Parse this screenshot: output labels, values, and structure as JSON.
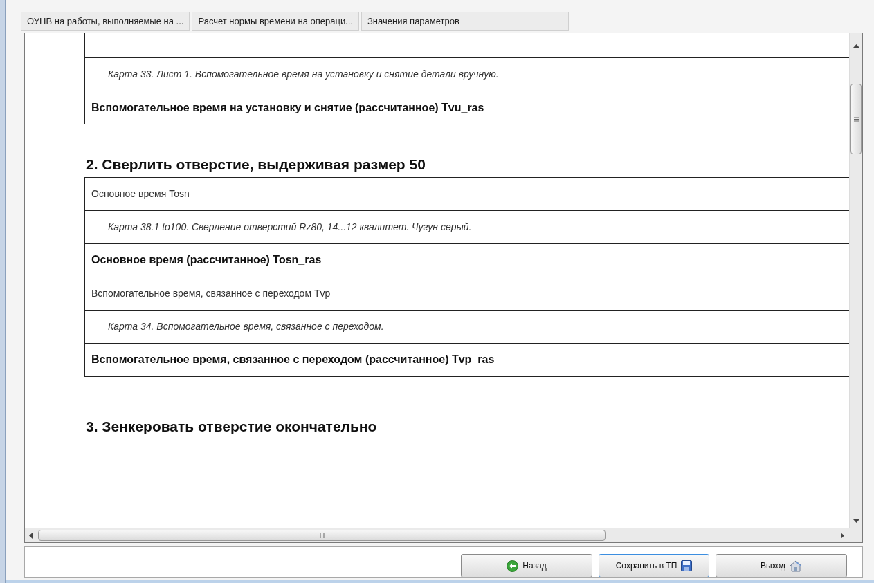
{
  "tabs": [
    {
      "label": "ОУНВ на работы, выполняемые на ...",
      "selected": false
    },
    {
      "label": "Расчет нормы времени на операци...",
      "selected": false
    },
    {
      "label": "Значения параметров",
      "selected": false
    }
  ],
  "document": {
    "sections": [
      {
        "rows": [
          {
            "kind": "reference",
            "text": "Карта 33. Лист 1. Вспомогательное время на установку и снятие детали вручную."
          },
          {
            "kind": "result",
            "text": "Вспомогательное время на установку и снятие (рассчитанное) Tvu_ras"
          }
        ]
      },
      {
        "heading": "2. Сверлить отверстие, выдерживая размер 50",
        "rows": [
          {
            "kind": "parameter",
            "text": "Основное время Tosn"
          },
          {
            "kind": "reference",
            "text": "Карта 38.1 to100. Сверление отверстий Rz80, 14...12 квалитет. Чугун серый."
          },
          {
            "kind": "result",
            "text": "Основное время (рассчитанное) Tosn_ras"
          },
          {
            "kind": "parameter",
            "text": "Вспомогательное время, связанное с переходом Tvp"
          },
          {
            "kind": "reference",
            "text": "Карта 34. Вспомогательное время, связанное с переходом."
          },
          {
            "kind": "result",
            "text": "Вспомогательное время, связанное с переходом (рассчитанное) Tvp_ras"
          }
        ]
      },
      {
        "heading": "3. Зенкеровать отверстие окончательно"
      }
    ]
  },
  "buttons": [
    {
      "kind": "back",
      "label": "Назад",
      "focused": false
    },
    {
      "kind": "save",
      "label": "Сохранить в ТП",
      "focused": true
    },
    {
      "kind": "exit",
      "label": "Выход",
      "focused": false
    }
  ]
}
